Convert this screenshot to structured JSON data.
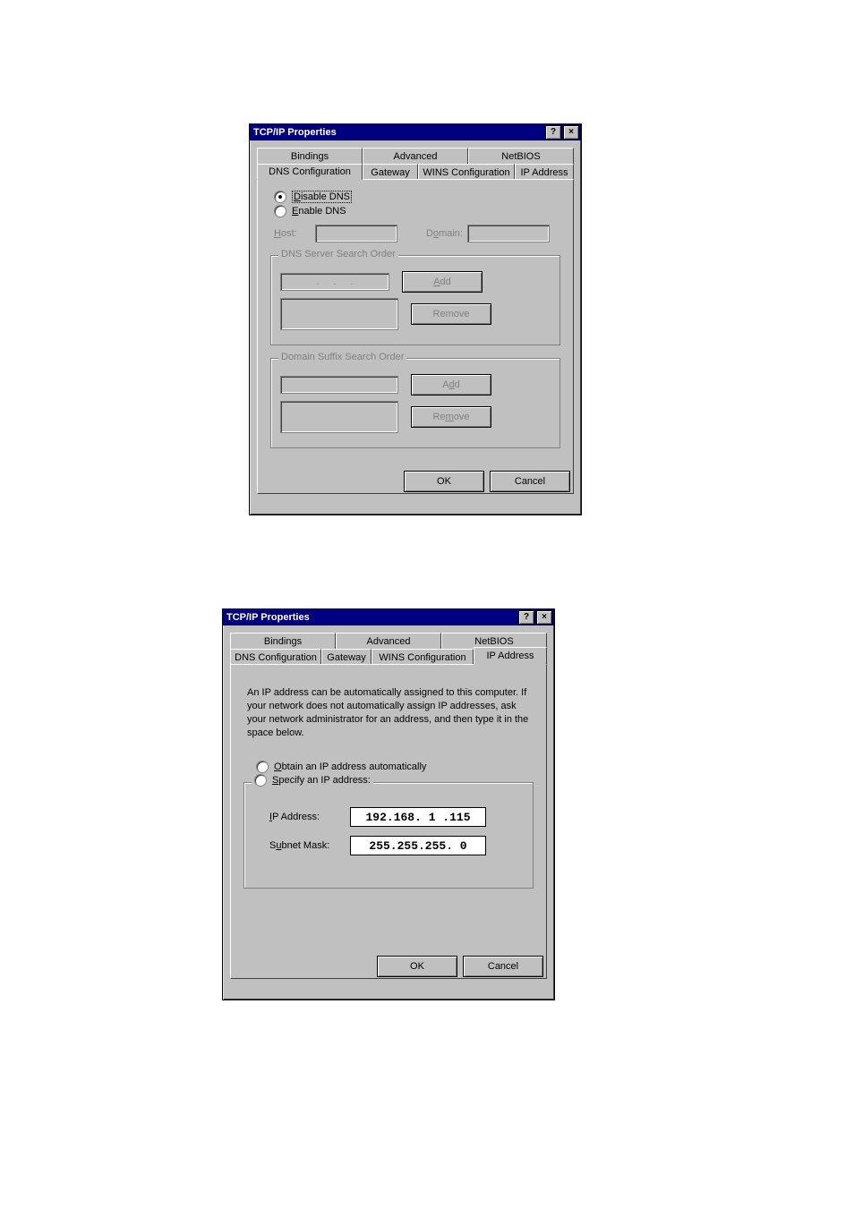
{
  "dialog1": {
    "title": "TCP/IP Properties",
    "tabs_row1": [
      "Bindings",
      "Advanced",
      "NetBIOS"
    ],
    "tabs_row2": [
      "DNS Configuration",
      "Gateway",
      "WINS Configuration",
      "IP Address"
    ],
    "active_tab": "DNS Configuration",
    "radio_disable": "Disable DNS",
    "radio_enable": "Enable DNS",
    "host_label": "Host:",
    "domain_label": "Domain:",
    "group1_legend": "DNS Server Search Order",
    "group2_legend": "Domain Suffix Search Order",
    "btn_add": "Add",
    "btn_remove": "Remove",
    "btn_ok": "OK",
    "btn_cancel": "Cancel"
  },
  "dialog2": {
    "title": "TCP/IP Properties",
    "tabs_row1": [
      "Bindings",
      "Advanced",
      "NetBIOS"
    ],
    "tabs_row2": [
      "DNS Configuration",
      "Gateway",
      "WINS Configuration",
      "IP Address"
    ],
    "active_tab": "IP Address",
    "description": "An IP address can be automatically assigned to this computer. If your network does not automatically assign IP addresses, ask your network administrator for an address, and then type it in the space below.",
    "radio_obtain": "Obtain an IP address automatically",
    "radio_specify": "Specify an IP address:",
    "ip_label": "IP Address:",
    "ip_value": "192.168. 1 .115",
    "subnet_label": "Subnet Mask:",
    "subnet_value": "255.255.255. 0",
    "btn_ok": "OK",
    "btn_cancel": "Cancel"
  }
}
